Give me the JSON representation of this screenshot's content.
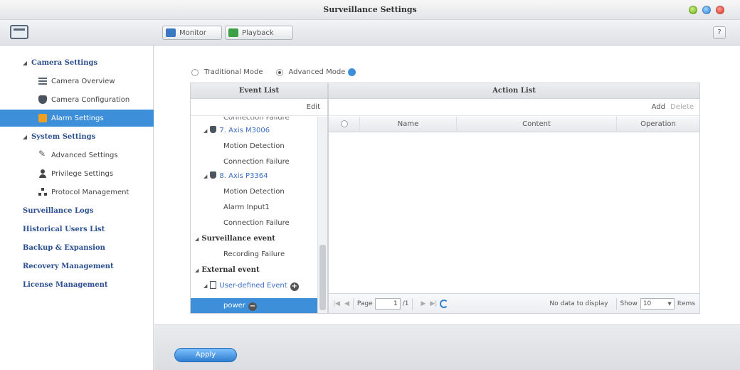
{
  "window": {
    "title": "Surveillance Settings"
  },
  "toolbar": {
    "monitor_label": "Monitor",
    "playback_label": "Playback",
    "help_label": "?"
  },
  "sidebar": {
    "camera_settings": "Camera Settings",
    "camera_overview": "Camera Overview",
    "camera_configuration": "Camera Configuration",
    "alarm_settings": "Alarm Settings",
    "system_settings": "System Settings",
    "advanced_settings": "Advanced Settings",
    "privilege_settings": "Privilege Settings",
    "protocol_management": "Protocol Management",
    "surveillance_logs": "Surveillance Logs",
    "historical_users_list": "Historical Users List",
    "backup_expansion": "Backup & Expansion",
    "recovery_management": "Recovery Management",
    "license_management": "License Management"
  },
  "modes": {
    "traditional": "Traditional Mode",
    "advanced": "Advanced Mode",
    "selected": "advanced"
  },
  "event_list": {
    "header": "Event List",
    "edit_label": "Edit",
    "items": {
      "cut_item": "Connection Failure",
      "cam7": "7. Axis M3006",
      "cam7_motion": "Motion Detection",
      "cam7_conn": "Connection Failure",
      "cam8": "8. Axis P3364",
      "cam8_motion": "Motion Detection",
      "cam8_alarm": "Alarm Input1",
      "cam8_conn": "Connection Failure",
      "surveillance_event": "Surveillance event",
      "recording_failure": "Recording Failure",
      "external_event": "External event",
      "user_defined": "User-defined Event",
      "selected_item": "power"
    }
  },
  "action_list": {
    "header": "Action List",
    "add_label": "Add",
    "delete_label": "Delete",
    "columns": {
      "name": "Name",
      "content": "Content",
      "operation": "Operation"
    }
  },
  "pager": {
    "page_label": "Page",
    "page_value": "1",
    "of_pages": "/1",
    "no_data": "No data to display",
    "show_label": "Show",
    "show_value": "10",
    "items_label": "Items"
  },
  "footer": {
    "apply_label": "Apply"
  }
}
